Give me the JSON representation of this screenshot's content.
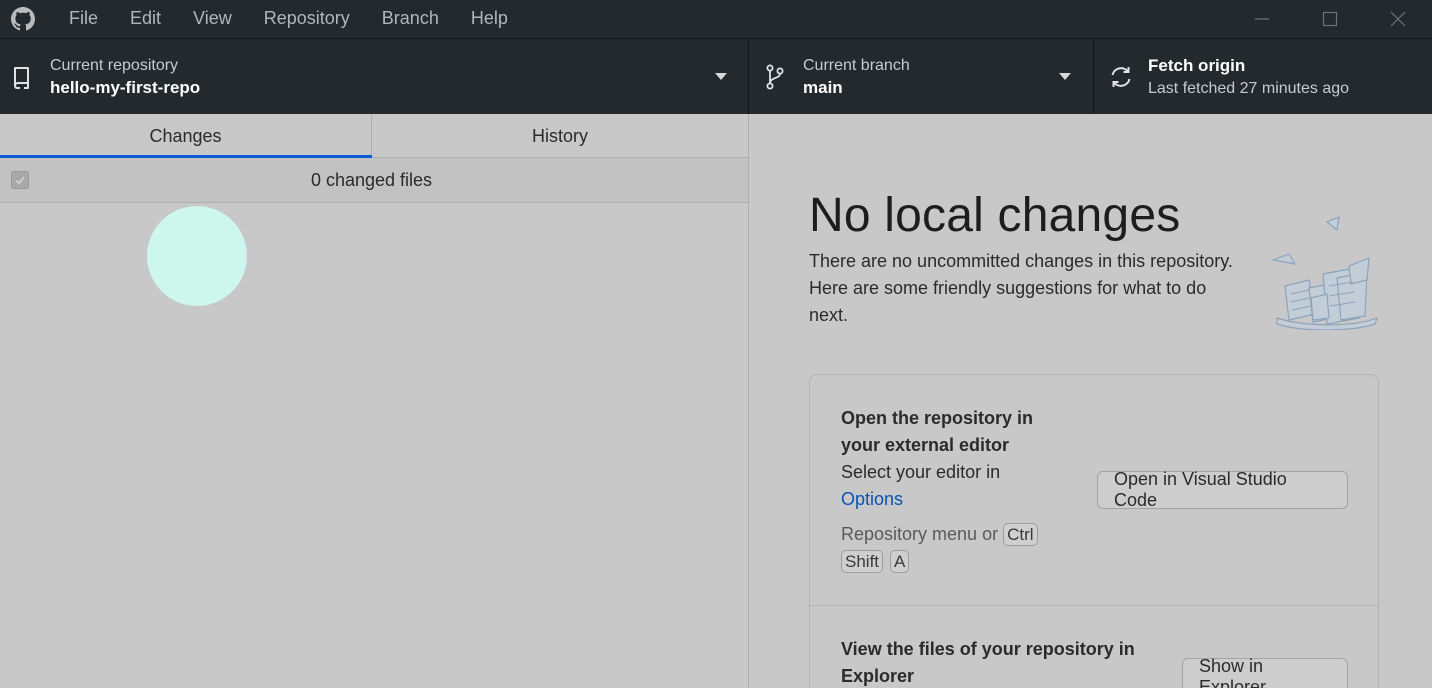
{
  "menu": [
    "File",
    "Edit",
    "View",
    "Repository",
    "Branch",
    "Help"
  ],
  "toolbar": {
    "repo_label": "Current repository",
    "repo_value": "hello-my-first-repo",
    "branch_label": "Current branch",
    "branch_value": "main",
    "fetch_label": "Fetch origin",
    "fetch_sub": "Last fetched 27 minutes ago"
  },
  "tabs": {
    "changes": "Changes",
    "history": "History"
  },
  "changes_list": {
    "count_label": "0 changed files"
  },
  "blank_slate": {
    "title": "No local changes",
    "description": "There are no uncommitted changes in this repository. Here are some friendly suggestions for what to do next."
  },
  "actions": {
    "editor": {
      "title": "Open the repository in your external editor",
      "desc_prefix": "Select your editor in",
      "desc_link": "Options",
      "shortcut_prefix": "Repository menu or",
      "keys": [
        "Ctrl",
        "Shift",
        "A"
      ],
      "button": "Open in Visual Studio Code"
    },
    "explorer": {
      "title": "View the files of your repository in Explorer",
      "button": "Show in Explorer"
    }
  },
  "colors": {
    "chrome_bg": "#24292e",
    "pane_bg": "#c8c8c8",
    "accent": "#0a5bd1",
    "link": "#0a53b3"
  }
}
